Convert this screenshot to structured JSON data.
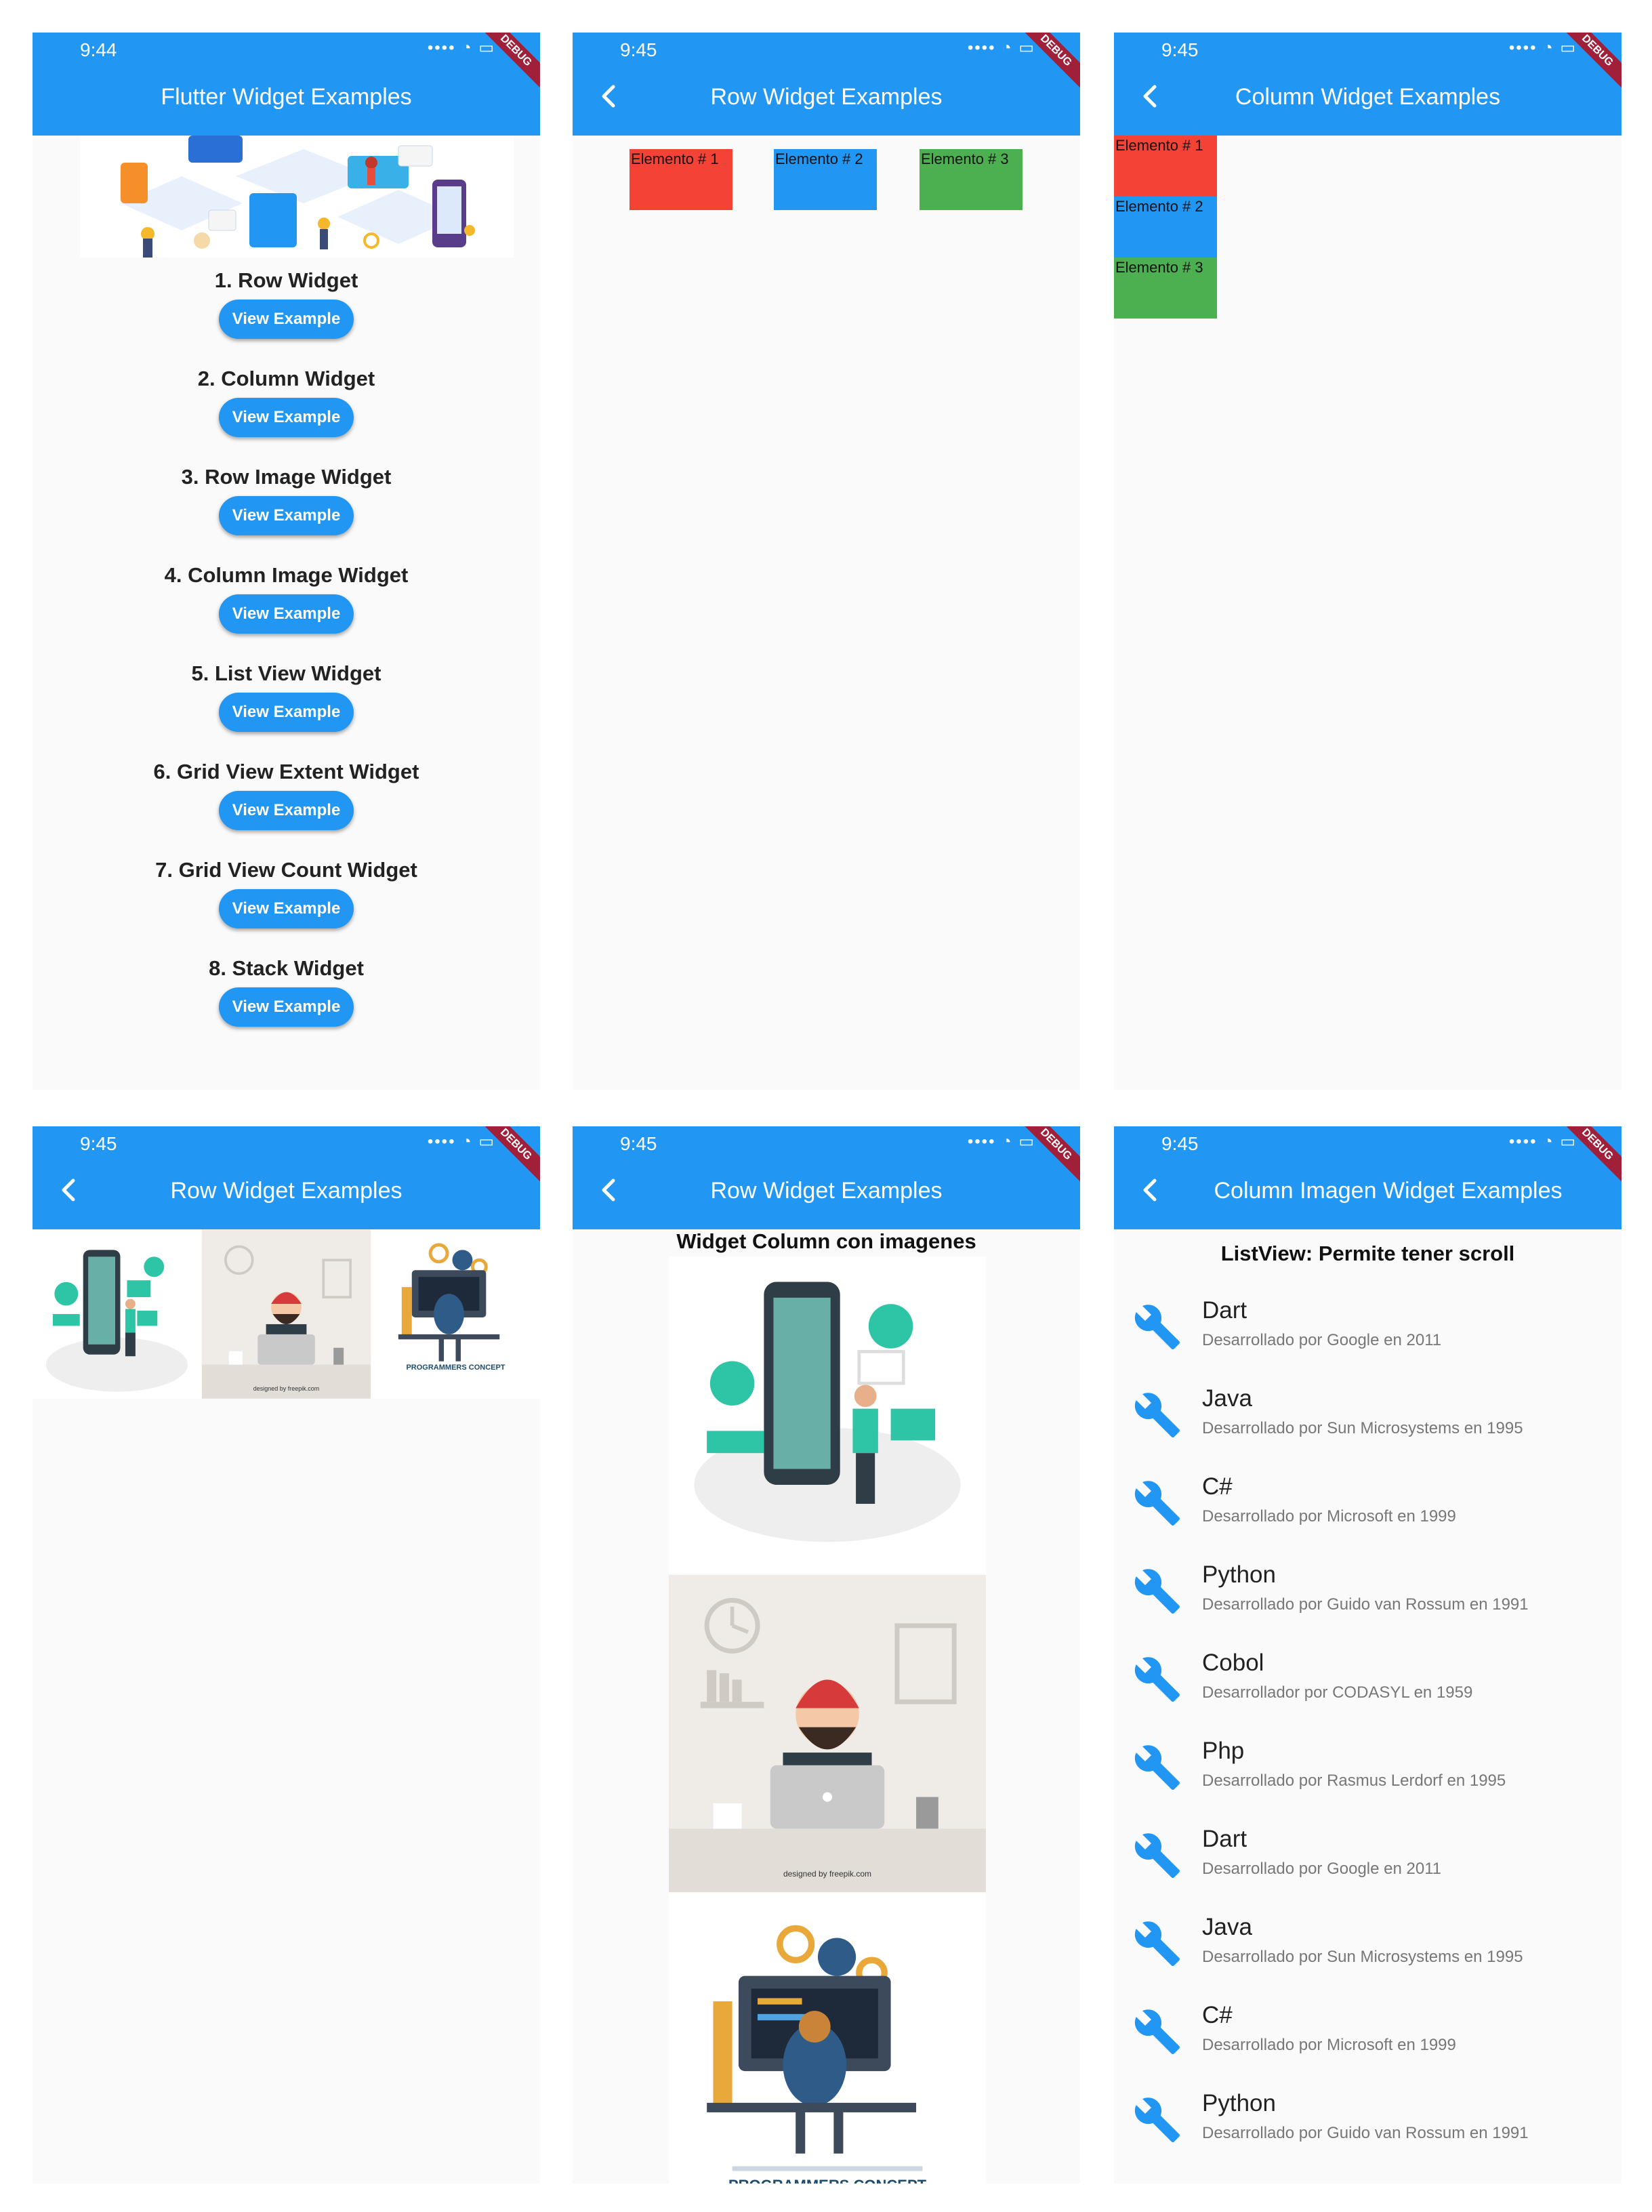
{
  "colors": {
    "primary": "#2196f3",
    "red": "#f44336",
    "green": "#4caf50",
    "debug": "#a0203a"
  },
  "screens": {
    "home": {
      "time": "9:44",
      "debug": "DEBUG",
      "title": "Flutter Widget Examples",
      "items": [
        {
          "label": "1. Row Widget",
          "button": "View Example"
        },
        {
          "label": "2. Column Widget",
          "button": "View Example"
        },
        {
          "label": "3. Row Image Widget",
          "button": "View Example"
        },
        {
          "label": "4. Column Image Widget",
          "button": "View Example"
        },
        {
          "label": "5. List View Widget",
          "button": "View Example"
        },
        {
          "label": "6. Grid View Extent Widget",
          "button": "View Example"
        },
        {
          "label": "7. Grid View Count Widget",
          "button": "View Example"
        },
        {
          "label": "8. Stack Widget",
          "button": "View Example"
        }
      ]
    },
    "row": {
      "time": "9:45",
      "debug": "DEBUG",
      "title": "Row Widget Examples",
      "boxes": [
        "Elemento # 1",
        "Elemento # 2",
        "Elemento # 3"
      ]
    },
    "column": {
      "time": "9:45",
      "debug": "DEBUG",
      "title": "Column Widget Examples",
      "boxes": [
        "Elemento # 1",
        "Elemento # 2",
        "Elemento # 3"
      ]
    },
    "rowimage": {
      "time": "9:45",
      "debug": "DEBUG",
      "title": "Row Widget Examples",
      "credit": "designed by freepik.com",
      "caption": "PROGRAMMERS CONCEPT"
    },
    "colimage": {
      "time": "9:45",
      "debug": "DEBUG",
      "title": "Row Widget Examples",
      "heading": "Widget Column con imagenes",
      "credit": "designed by freepik.com",
      "caption": "PROGRAMMERS CONCEPT"
    },
    "listview": {
      "time": "9:45",
      "debug": "DEBUG",
      "title": "Column Imagen Widget Examples",
      "heading": "ListView: Permite tener scroll",
      "items": [
        {
          "title": "Dart",
          "subtitle": "Desarrollado por Google en 2011"
        },
        {
          "title": "Java",
          "subtitle": "Desarrollado por Sun Microsystems en 1995"
        },
        {
          "title": "C#",
          "subtitle": "Desarrollado por Microsoft en 1999"
        },
        {
          "title": "Python",
          "subtitle": "Desarrollado por Guido van Rossum en 1991"
        },
        {
          "title": "Cobol",
          "subtitle": "Desarrollador por CODASYL en 1959"
        },
        {
          "title": "Php",
          "subtitle": "Desarrollado por Rasmus Lerdorf en 1995"
        },
        {
          "title": "Dart",
          "subtitle": "Desarrollado por Google en 2011"
        },
        {
          "title": "Java",
          "subtitle": "Desarrollado por Sun Microsystems en 1995"
        },
        {
          "title": "C#",
          "subtitle": "Desarrollado por Microsoft en 1999"
        },
        {
          "title": "Python",
          "subtitle": "Desarrollado por Guido van Rossum en 1991"
        }
      ]
    }
  }
}
